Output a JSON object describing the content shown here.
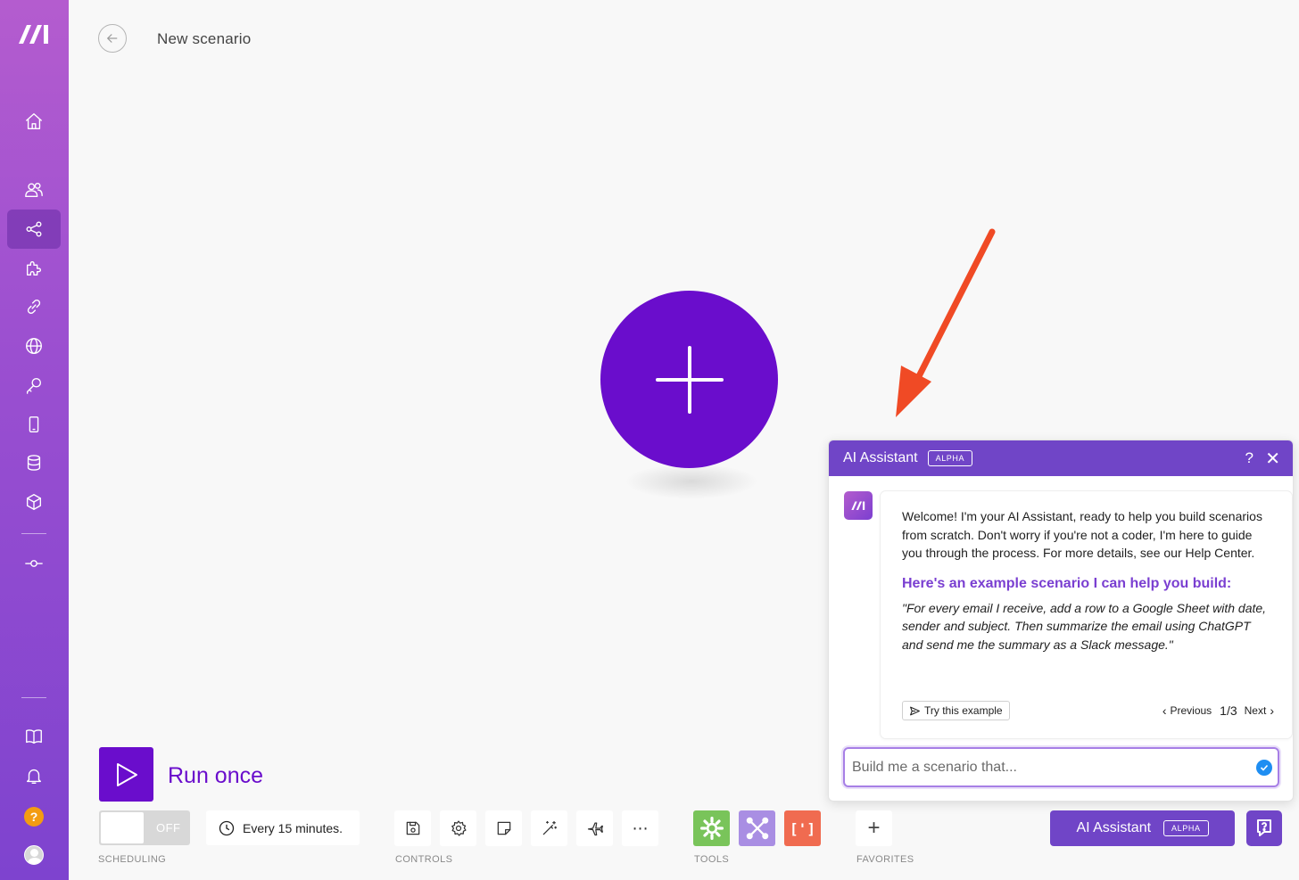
{
  "header": {
    "title": "New scenario"
  },
  "sidebar": {
    "items": [
      {
        "name": "home"
      },
      {
        "name": "team"
      },
      {
        "name": "scenarios",
        "active": true
      },
      {
        "name": "templates"
      },
      {
        "name": "connections"
      },
      {
        "name": "webhooks"
      },
      {
        "name": "keys"
      },
      {
        "name": "devices"
      },
      {
        "name": "data-stores"
      },
      {
        "name": "data-structures"
      }
    ],
    "help_badge": "?"
  },
  "ai_panel": {
    "title": "AI Assistant",
    "badge": "ALPHA",
    "help_glyph": "?",
    "close_glyph": "✕",
    "welcome": "Welcome! I'm your AI Assistant, ready to help you build scenarios from scratch. Don't worry if you're not a coder, I'm here to guide you through the process. For more details, see our Help Center.",
    "example_heading": "Here's an example scenario I can help you build:",
    "example_text": "\"For every email I receive, add a row to a Google Sheet with date, sender and subject. Then summarize the email using ChatGPT and send me the summary as a Slack message.\"",
    "try_label": "Try this example",
    "previous_label": "Previous",
    "page_indicator": "1/3",
    "next_label": "Next",
    "input_placeholder": "Build me a scenario that..."
  },
  "run": {
    "label": "Run once"
  },
  "scheduling": {
    "toggle_text": "OFF",
    "interval": "Every 15 minutes.",
    "section_label": "SCHEDULING"
  },
  "controls": {
    "section_label": "CONTROLS",
    "more_glyph": "⋯"
  },
  "tools": {
    "section_label": "TOOLS",
    "colors": {
      "flow": "#79c45a",
      "tools": "#a98ee3",
      "text": "#f06b50"
    },
    "text_glyph": "[']"
  },
  "favorites": {
    "section_label": "FAVORITES",
    "add_glyph": "+"
  },
  "bottom_ai": {
    "label": "AI Assistant",
    "badge": "ALPHA"
  },
  "colors": {
    "accent": "#6a0dcc",
    "panel_header": "#7045c7",
    "annotation_arrow": "#f04a25"
  }
}
